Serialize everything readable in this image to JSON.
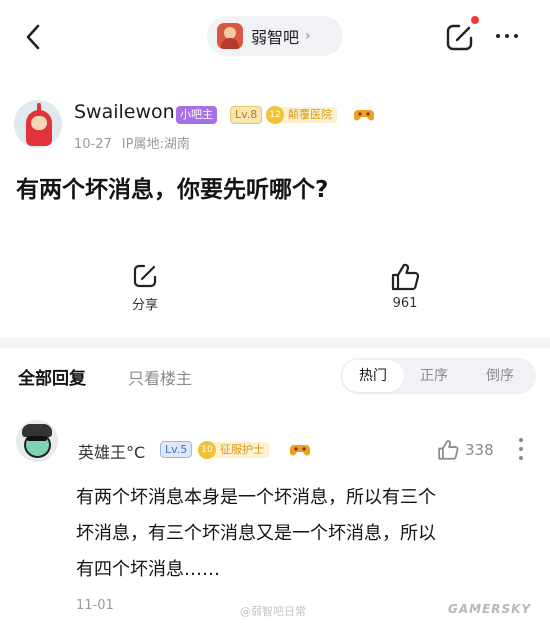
{
  "header": {
    "forum_name": "弱智吧",
    "chevron": "›"
  },
  "post": {
    "author": "Swailewon",
    "badge_moderator": "小吧主",
    "badge_level": "Lv.8",
    "badge_title_level": "12",
    "badge_title": "颠覆医院",
    "date": "10-27",
    "ip_location": "IP属地:湖南",
    "title": "有两个坏消息，你要先听哪个?",
    "share_label": "分享",
    "like_count": "961"
  },
  "replies_bar": {
    "all_replies": "全部回复",
    "host_only": "只看楼主",
    "sort_hot": "热门",
    "sort_asc": "正序",
    "sort_desc": "倒序"
  },
  "reply": {
    "author": "英雄王°C",
    "level": "Lv.5",
    "title_level": "10",
    "title": "征服护士",
    "like_count": "338",
    "lines": [
      "有两个坏消息本身是一个坏消息，所以有三个",
      "坏消息，有三个坏消息又是一个坏消息，所以",
      "有四个坏消息……"
    ],
    "date": "11-01"
  },
  "watermarks": {
    "center": "@弱智吧日常",
    "right": "GAMERSKY"
  },
  "colors": {
    "moderator_badge": "#a86fe6",
    "title_badge": "#d89a16",
    "level_badge_reply": "#3b6fd0",
    "notification_dot": "#f23a3a",
    "divider": "#f4f4f6"
  },
  "icons": [
    "back-arrow-icon",
    "forum-avatar",
    "edit-icon",
    "more-icon",
    "game-controller-icon",
    "share-icon",
    "thumbs-up-icon"
  ]
}
